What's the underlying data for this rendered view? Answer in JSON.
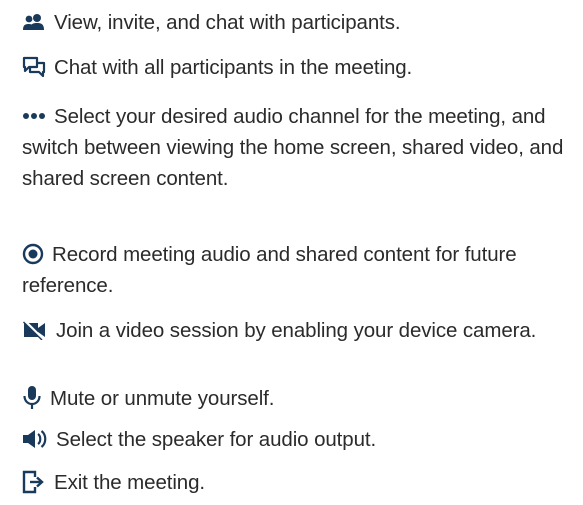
{
  "items": [
    {
      "icon": "participants-icon",
      "text": "View, invite, and chat with participants."
    },
    {
      "icon": "chat-icon",
      "text": "Chat with all participants in the meeting."
    },
    {
      "icon": "more-options-icon",
      "text": "Select your desired audio channel for the meeting, and switch between viewing the home screen, shared video, and shared screen content."
    },
    {
      "icon": "record-icon",
      "text": "Record meeting audio and shared content for future reference."
    },
    {
      "icon": "video-off-icon",
      "text": "Join a video session by enabling your device camera."
    },
    {
      "icon": "microphone-icon",
      "text": "Mute or unmute yourself."
    },
    {
      "icon": "speaker-icon",
      "text": "Select the speaker for audio output."
    },
    {
      "icon": "exit-icon",
      "text": "Exit the meeting."
    }
  ],
  "colors": {
    "icon": "#1a3a5c",
    "text": "#2b2b2b"
  }
}
